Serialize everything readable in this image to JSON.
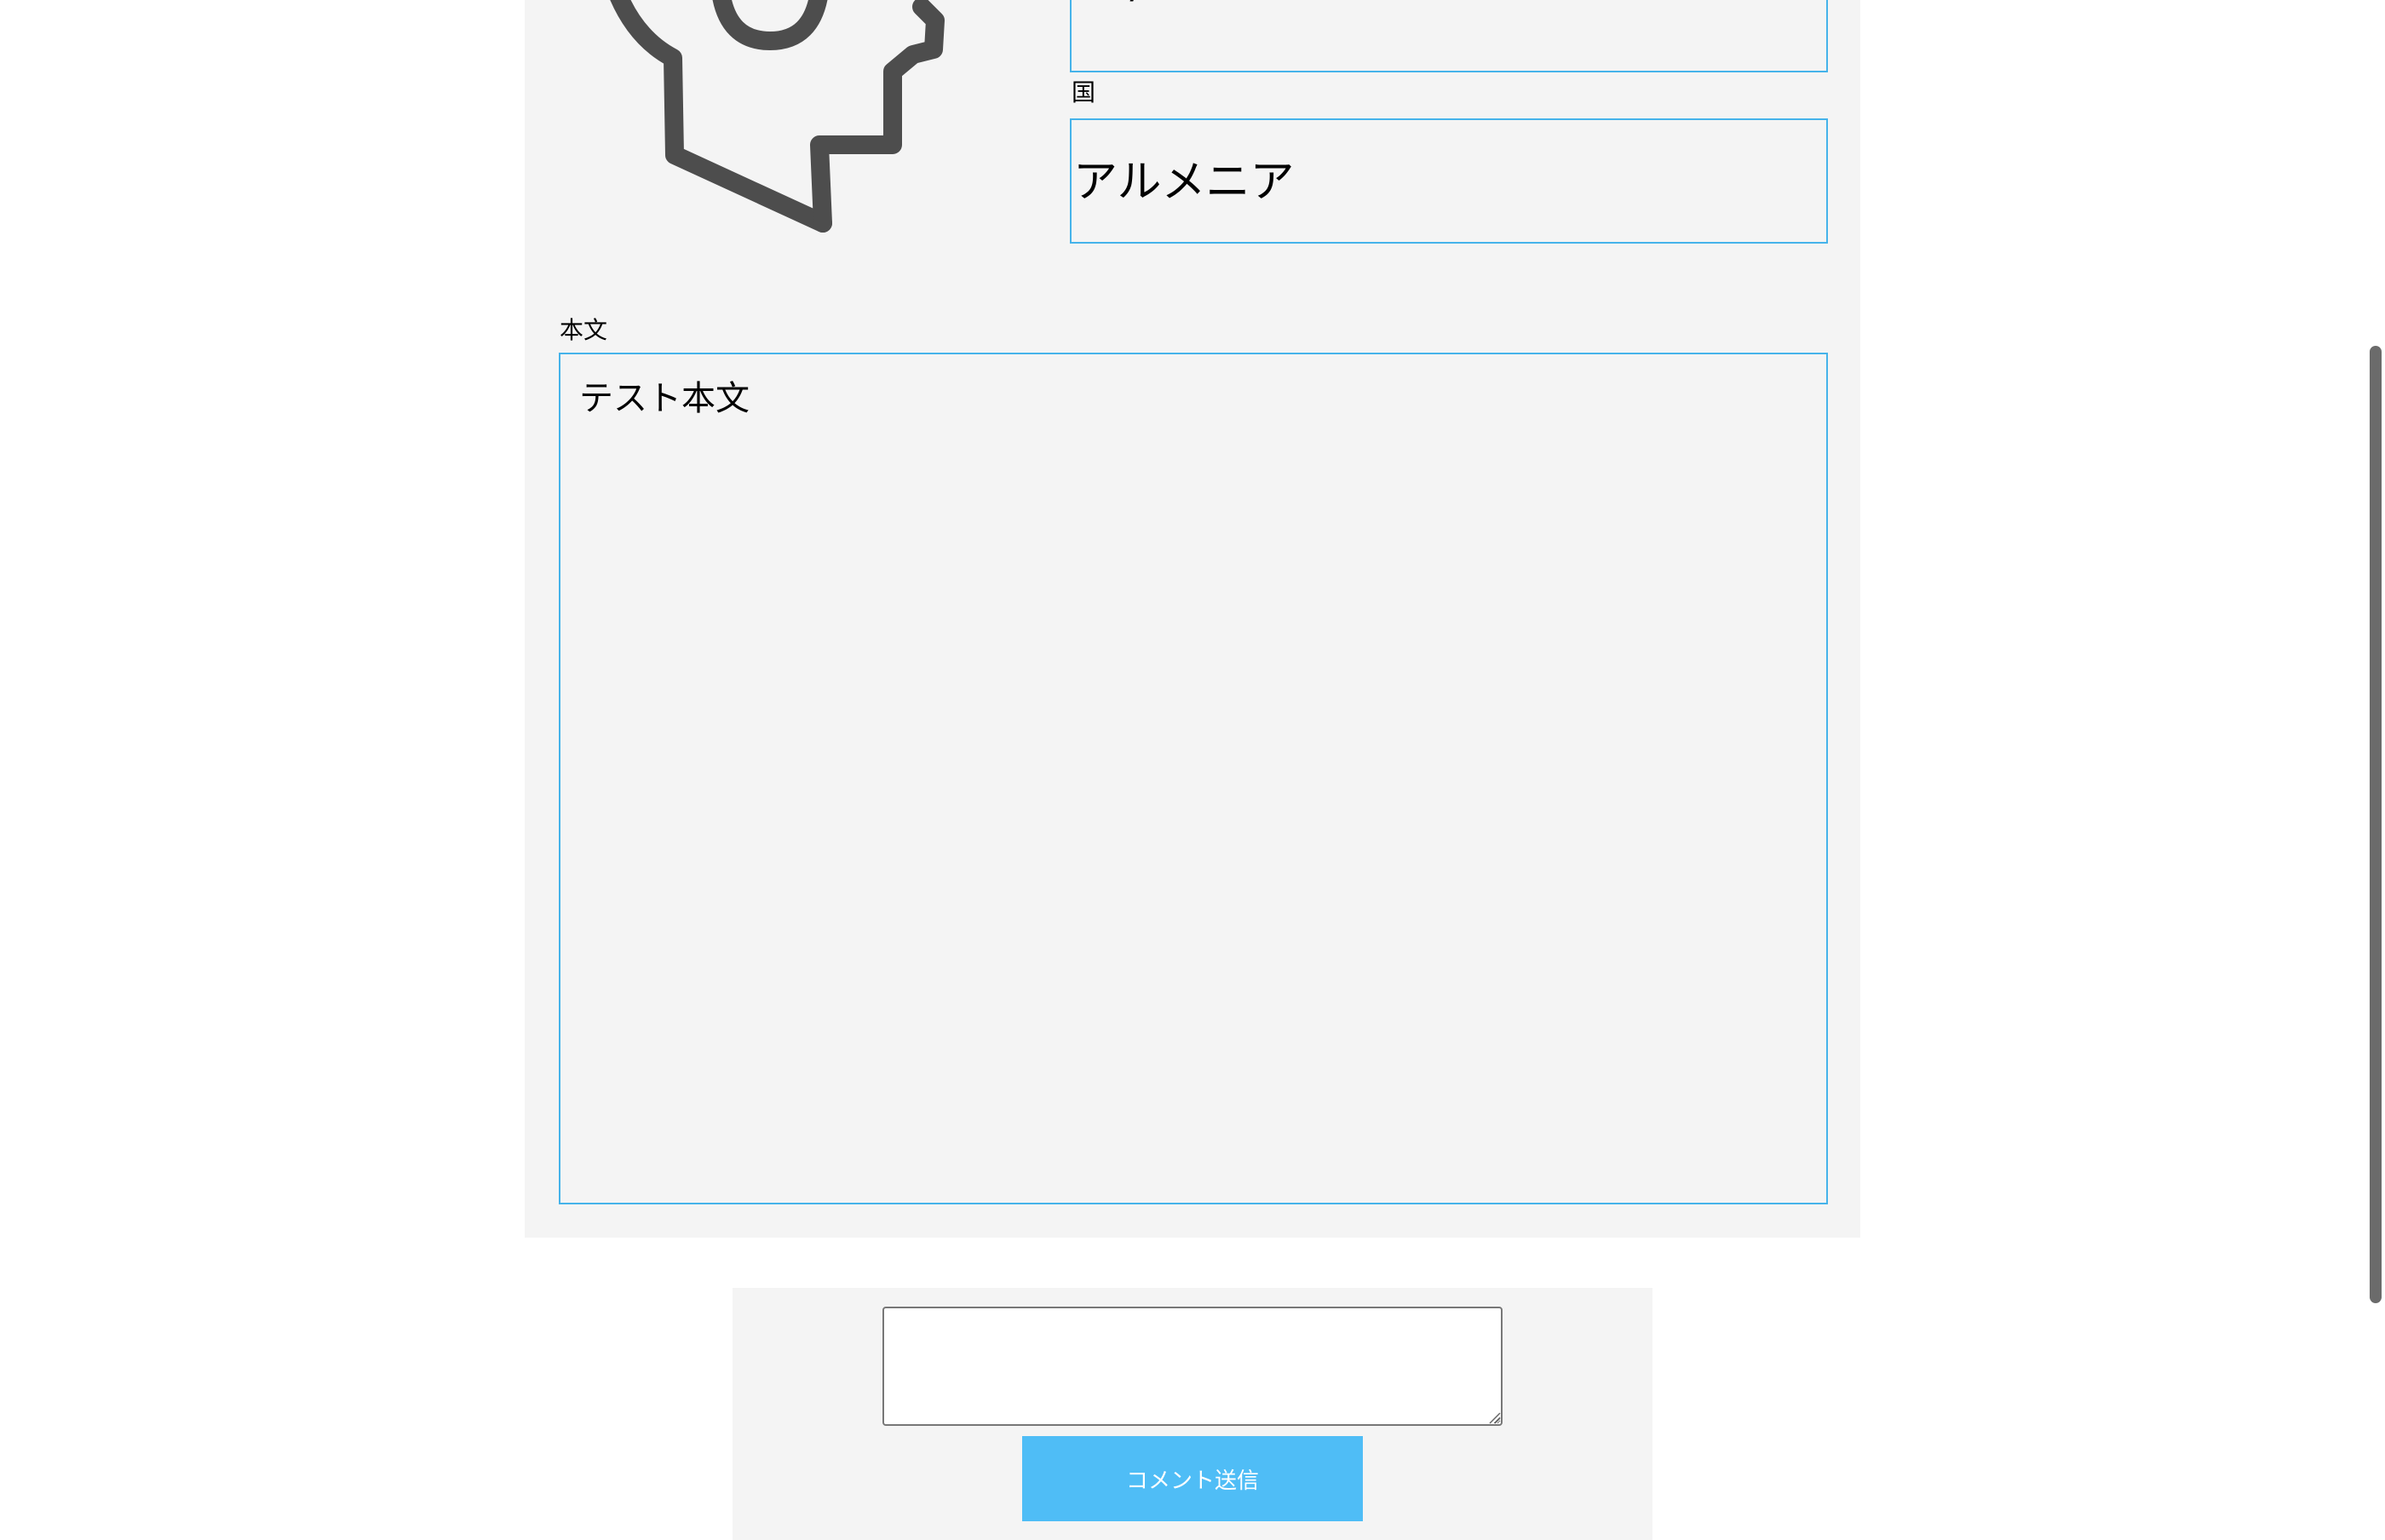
{
  "post": {
    "avatar_icon": "person-head-gear-icon",
    "genre_value": "HR/HM",
    "country_label": "国",
    "country_value": "アルメニア",
    "body_label": "本文",
    "body_value": "テスト本文"
  },
  "comment": {
    "input_value": "",
    "input_placeholder": "",
    "submit_label": "コメント送信"
  },
  "colors": {
    "field_border": "#45b3ea",
    "panel_bg": "#f4f4f4",
    "button_bg": "#4fbdf6",
    "button_text": "#ffffff",
    "icon_stroke": "#4d4d4d"
  }
}
